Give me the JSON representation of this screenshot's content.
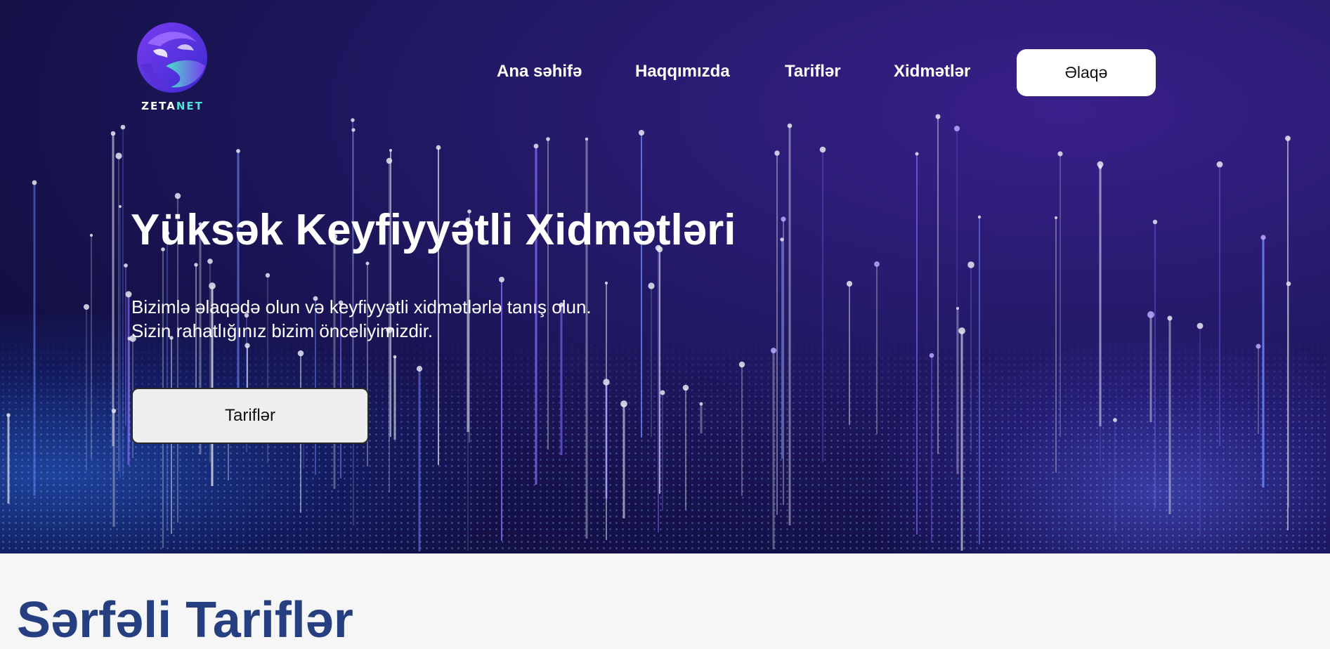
{
  "brand": {
    "name_part1": "ZETA",
    "name_part2": "NET",
    "accent_color": "#4fe3d3"
  },
  "nav": {
    "items": [
      {
        "label": "Ana səhifə"
      },
      {
        "label": "Haqqımızda"
      },
      {
        "label": "Tariflər"
      },
      {
        "label": "Xidmətlər"
      }
    ],
    "cta_label": "Əlaqə"
  },
  "hero": {
    "title": "Yüksək Keyfiyyətli Xidmətləri",
    "subtitle_line1": "Bizimlə əlaqədə olun və keyfiyyətli xidmətlərlə tanış olun.",
    "subtitle_line2": "Sizin rahatlığınız bizim önceliyimizdir.",
    "button_label": "Tariflər",
    "background_colors": [
      "#0f0d3a",
      "#241a6a",
      "#3a1f8a"
    ]
  },
  "pricing_section": {
    "title": "Sərfəli Tariflər",
    "title_color": "#253f80"
  }
}
